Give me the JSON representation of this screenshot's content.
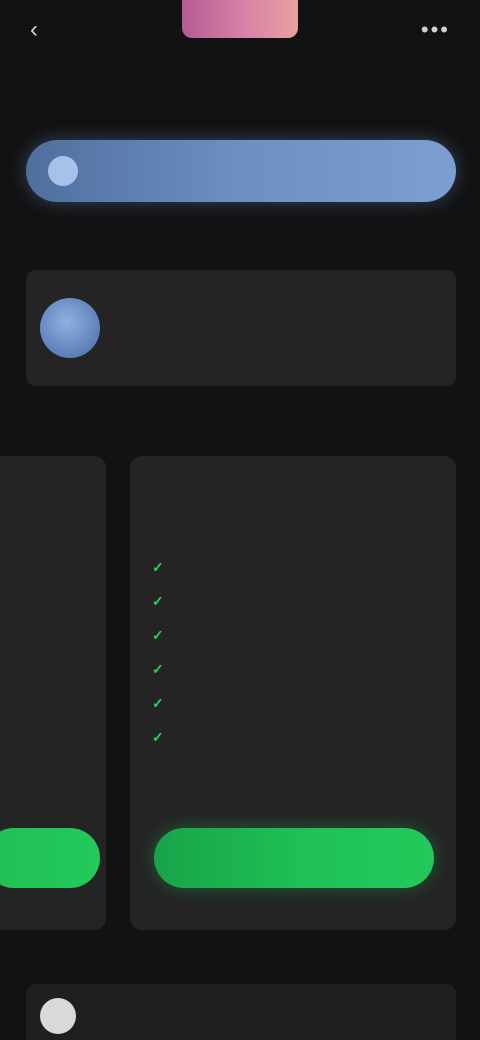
{
  "header": {
    "back_icon": "chevron-left-icon",
    "back_label": "",
    "title": "",
    "side_label": "",
    "menu_label": "",
    "menu_icon": "more-icon"
  },
  "promo": {
    "icon": "info-icon",
    "icon_glyph": "",
    "text": ""
  },
  "account": {
    "section_label": "",
    "avatar_initial": "",
    "name": ""
  },
  "plans": {
    "section_label": "",
    "left_card": {
      "texts": [
        "",
        "",
        "",
        "",
        ""
      ]
    },
    "main_card": {
      "kicker": "",
      "name": "",
      "features": [
        {
          "text": ""
        },
        {
          "text": ""
        },
        {
          "text": ""
        },
        {
          "text": ""
        },
        {
          "text": ""
        },
        {
          "text": ""
        }
      ],
      "terms": "",
      "cta_label": ""
    }
  },
  "bottom": {
    "section_label": "",
    "text": ""
  },
  "colors": {
    "background": "#121212",
    "card": "#242424",
    "accent_green": "#1ed760",
    "promo_blue": "#6d8fc2",
    "hero_pink": "#d982a8"
  }
}
